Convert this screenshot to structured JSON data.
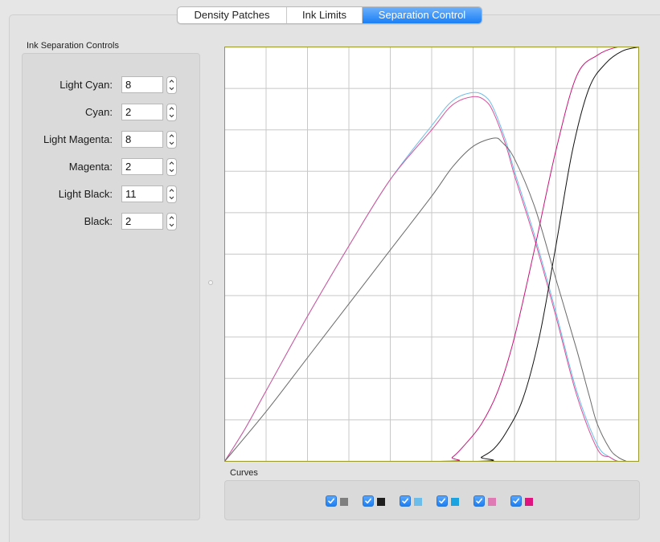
{
  "tabs": [
    {
      "label": "Density Patches",
      "active": false
    },
    {
      "label": "Ink Limits",
      "active": false
    },
    {
      "label": "Separation Control",
      "active": true
    }
  ],
  "controls": {
    "title": "Ink Separation Controls",
    "rows": [
      {
        "label": "Light Cyan:",
        "value": "8"
      },
      {
        "label": "Cyan:",
        "value": "2"
      },
      {
        "label": "Light Magenta:",
        "value": "8"
      },
      {
        "label": "Magenta:",
        "value": "2"
      },
      {
        "label": "Light Black:",
        "value": "11"
      },
      {
        "label": "Black:",
        "value": "2"
      }
    ]
  },
  "curves": {
    "title": "Curves",
    "items": [
      {
        "ink": "light-black",
        "checked": true,
        "color": "#7f7f7f"
      },
      {
        "ink": "black",
        "checked": true,
        "color": "#1e1e1e"
      },
      {
        "ink": "light-cyan",
        "checked": true,
        "color": "#6cbde9"
      },
      {
        "ink": "cyan",
        "checked": true,
        "color": "#1aa3e0"
      },
      {
        "ink": "light-magenta",
        "checked": true,
        "color": "#e07ab4"
      },
      {
        "ink": "magenta",
        "checked": true,
        "color": "#e0147f"
      }
    ]
  },
  "colors": {
    "accent": "#1a7ff6",
    "plot_border": "#9a9a2a",
    "grid": "#c8c8c8"
  },
  "chart_data": {
    "type": "line",
    "x": [
      0,
      10,
      20,
      30,
      40,
      50,
      60,
      70,
      80,
      90,
      100
    ],
    "xlim": [
      0,
      100
    ],
    "ylim": [
      0,
      100
    ],
    "grid": true,
    "series": [
      {
        "ink": "light-cyan",
        "color": "#6cbde9",
        "x": [
          0,
          5,
          10,
          20,
          30,
          40,
          50,
          55,
          60,
          63,
          65,
          68,
          70,
          75,
          80,
          85,
          90,
          93,
          95,
          97
        ],
        "y": [
          0,
          8,
          17,
          35,
          52,
          68,
          81,
          87,
          89,
          88,
          85,
          77,
          70,
          54,
          36,
          17,
          4,
          1,
          0,
          0
        ]
      },
      {
        "ink": "light-magenta",
        "color": "#d7529c",
        "x": [
          0,
          5,
          10,
          20,
          30,
          40,
          50,
          55,
          60,
          63,
          65,
          68,
          70,
          75,
          80,
          85,
          90,
          93,
          95,
          97
        ],
        "y": [
          0,
          8,
          17,
          35,
          52,
          68,
          80,
          86,
          88,
          87,
          84,
          76,
          69,
          53,
          35,
          16,
          3,
          1,
          0,
          0
        ]
      },
      {
        "ink": "light-black",
        "color": "#6a6a6a",
        "x": [
          0,
          10,
          20,
          30,
          40,
          50,
          55,
          60,
          65,
          67,
          70,
          75,
          80,
          85,
          88,
          90,
          93,
          95,
          97
        ],
        "y": [
          0,
          12,
          25,
          38,
          51,
          64,
          71,
          76,
          78,
          77,
          73,
          61,
          44,
          27,
          16,
          9,
          3,
          1,
          0
        ]
      },
      {
        "ink": "magenta",
        "color": "#c8157a",
        "x": [
          0,
          52,
          55,
          58,
          62,
          66,
          70,
          75,
          80,
          85,
          90,
          95,
          100
        ],
        "y": [
          0,
          0,
          1,
          4,
          9,
          17,
          30,
          52,
          75,
          93,
          98,
          100,
          100
        ]
      },
      {
        "ink": "black",
        "color": "#111111",
        "x": [
          0,
          60,
          62,
          65,
          68,
          72,
          76,
          80,
          84,
          88,
          92,
          96,
          100
        ],
        "y": [
          0,
          0,
          1,
          3,
          7,
          15,
          30,
          52,
          75,
          90,
          96,
          99,
          100
        ]
      }
    ]
  }
}
